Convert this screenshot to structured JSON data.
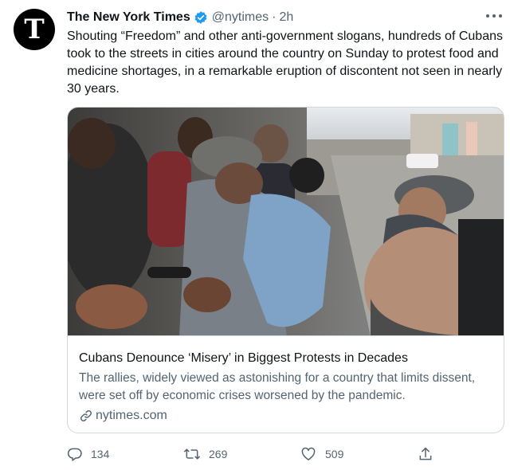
{
  "tweet": {
    "author_name": "The New York Times",
    "handle": "@nytimes",
    "separator": "·",
    "time": "2h",
    "avatar_letter": "T",
    "text": "Shouting “Freedom” and other anti-government slogans, hundreds of Cubans took to the streets in cities around the country on Sunday to protest food and medicine shortages, in a remarkable eruption of discontent not seen in nearly 30 years."
  },
  "card": {
    "title": "Cubans Denounce ‘Misery’ in Biggest Protests in Decades",
    "description": "The rallies, widely viewed as astonishing for a country that limits dissent, were set off by economic crises worsened by the pandemic.",
    "domain": "nytimes.com"
  },
  "actions": {
    "replies": "134",
    "retweets": "269",
    "likes": "509"
  },
  "icons": {
    "avatar": "nyt-logo-icon",
    "verified": "verified-badge-icon",
    "more": "more-options-icon",
    "link": "link-icon",
    "reply": "reply-icon",
    "retweet": "retweet-icon",
    "like": "heart-icon",
    "share": "share-icon"
  },
  "colors": {
    "verified": "#1d9bf0",
    "text_primary": "#0f1419",
    "text_secondary": "#536471",
    "border": "#cfd9de"
  }
}
